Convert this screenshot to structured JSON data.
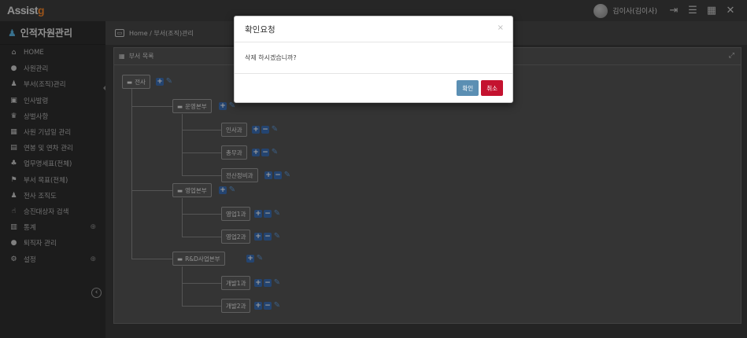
{
  "app": {
    "logo_prefix": "Assist",
    "logo_accent": "g"
  },
  "topbar": {
    "username": "김이사(김이사)",
    "icons": [
      "logout-icon",
      "menu-icon",
      "grid-icon",
      "fullscreen-icon"
    ],
    "icon_glyphs": [
      "⇥",
      "☰",
      "▦",
      "✕"
    ]
  },
  "sidebar": {
    "title": "인적자원관리",
    "items": [
      {
        "label": "HOME",
        "icon": "home-icon",
        "glyph": "⌂"
      },
      {
        "label": "사원관리",
        "icon": "user-icon",
        "glyph": "●"
      },
      {
        "label": "부서(조직)관리",
        "icon": "users-icon",
        "glyph": "♟"
      },
      {
        "label": "인사발령",
        "icon": "calendar-icon",
        "glyph": "▣"
      },
      {
        "label": "상벌사항",
        "icon": "trophy-icon",
        "glyph": "♛"
      },
      {
        "label": "사원 기념일 관리",
        "icon": "calendar-grid-icon",
        "glyph": "▦"
      },
      {
        "label": "연봉 및 연차 관리",
        "icon": "money-icon",
        "glyph": "▤"
      },
      {
        "label": "업무명세표(전체)",
        "icon": "sitemap-icon",
        "glyph": "♣"
      },
      {
        "label": "부서 목표(전체)",
        "icon": "flag-icon",
        "glyph": "⚑"
      },
      {
        "label": "전사 조직도",
        "icon": "org-icon",
        "glyph": "♟"
      },
      {
        "label": "승진대상자 검색",
        "icon": "thumbs-up-icon",
        "glyph": "☝"
      },
      {
        "label": "통계",
        "icon": "chart-icon",
        "glyph": "▥",
        "expandable": true
      },
      {
        "label": "퇴직자 관리",
        "icon": "user-out-icon",
        "glyph": "●"
      },
      {
        "label": "설정",
        "icon": "cogs-icon",
        "glyph": "⚙",
        "expandable": true
      }
    ]
  },
  "breadcrumb": {
    "text": "Home / 부서(조직)관리"
  },
  "panel": {
    "title": "부서 목록"
  },
  "tree": {
    "root": "전사",
    "divisions": [
      "운영본부",
      "영업본부",
      "R&D사업본부"
    ],
    "teams": [
      "인사과",
      "총무과",
      "전산정비과",
      "영업1과",
      "영업2과",
      "개발1과",
      "개발2과"
    ]
  },
  "modal": {
    "title": "확인요청",
    "message": "삭제 하시겠습니까?",
    "ok_label": "확인",
    "cancel_label": "취소"
  }
}
